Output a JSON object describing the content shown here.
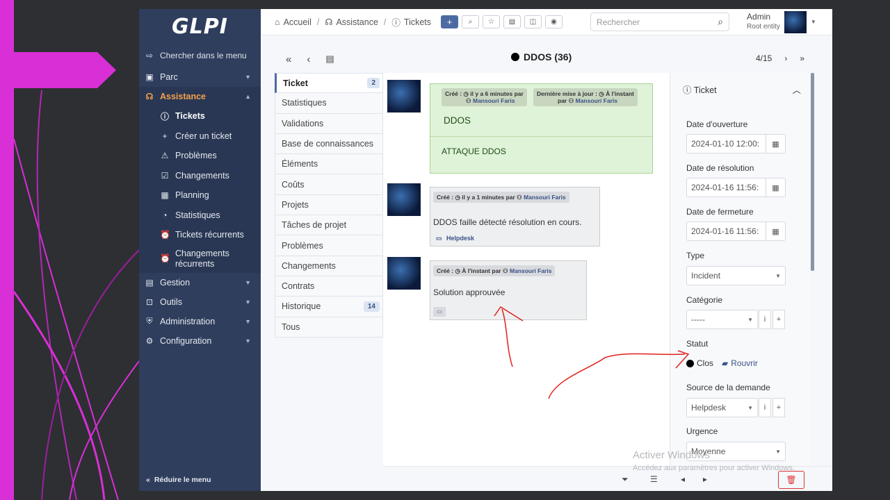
{
  "sidebar": {
    "logo": "GLPI",
    "search": "Chercher dans le menu",
    "parc": "Parc",
    "assistance": "Assistance",
    "sub": [
      "Tickets",
      "Créer un ticket",
      "Problèmes",
      "Changements",
      "Planning",
      "Statistiques",
      "Tickets récurrents",
      "Changements récurrents"
    ],
    "gestion": "Gestion",
    "outils": "Outils",
    "administration": "Administration",
    "configuration": "Configuration",
    "reduce": "Réduire le menu"
  },
  "breadcrumb": {
    "home": "Accueil",
    "assistance": "Assistance",
    "tickets": "Tickets"
  },
  "search": {
    "placeholder": "Rechercher"
  },
  "user": {
    "name": "Admin",
    "entity": "Root entity"
  },
  "ticket": {
    "title": "DDOS (36)",
    "pager": "4/15"
  },
  "tabs": [
    {
      "label": "Ticket",
      "badge": "2"
    },
    {
      "label": "Statistiques"
    },
    {
      "label": "Validations"
    },
    {
      "label": "Base de connaissances"
    },
    {
      "label": "Éléments"
    },
    {
      "label": "Coûts"
    },
    {
      "label": "Projets"
    },
    {
      "label": "Tâches de projet"
    },
    {
      "label": "Problèmes"
    },
    {
      "label": "Changements"
    },
    {
      "label": "Contrats"
    },
    {
      "label": "Historique",
      "badge": "14"
    },
    {
      "label": "Tous"
    }
  ],
  "timeline": {
    "item1": {
      "created": "Créé :",
      "when": "il y a 6 minutes par",
      "author": "Mansouri Faris",
      "updated": "Dernière mise à jour :",
      "updated_when": "À l'instant",
      "par": "par",
      "updated_author": "Mansouri Faris",
      "title": "DDOS",
      "content": "ATTAQUE DDOS"
    },
    "item2": {
      "created": "Créé :",
      "when": "il y a 1 minutes par",
      "author": "Mansouri Faris",
      "content": "DDOS faille détecté résolution en cours.",
      "source": "Helpdesk"
    },
    "item3": {
      "created": "Créé :",
      "when": "À l'instant par",
      "author": "Mansouri Faris",
      "content": "Solution approuvée"
    }
  },
  "panel": {
    "header": "Ticket",
    "opening_label": "Date d'ouverture",
    "opening_value": "2024-01-10 12:00:",
    "resolution_label": "Date de résolution",
    "resolution_value": "2024-01-16 11:56:",
    "closing_label": "Date de fermeture",
    "closing_value": "2024-01-16 11:56:",
    "type_label": "Type",
    "type_value": "Incident",
    "category_label": "Catégorie",
    "category_value": "-----",
    "status_label": "Statut",
    "status_value": "Clos",
    "reopen": "Rouvrir",
    "source_label": "Source de la demande",
    "source_value": "Helpdesk",
    "urgency_label": "Urgence",
    "urgency_value": "Moyenne"
  },
  "watermark": {
    "title": "Activer Windows",
    "subtitle": "Accédez aux paramètres pour activer Windows."
  },
  "colors": {
    "sidebar": "#2f3e5d",
    "accent": "#f5a04a",
    "magenta": "#d92fd6",
    "annotation": "#e0201c"
  }
}
